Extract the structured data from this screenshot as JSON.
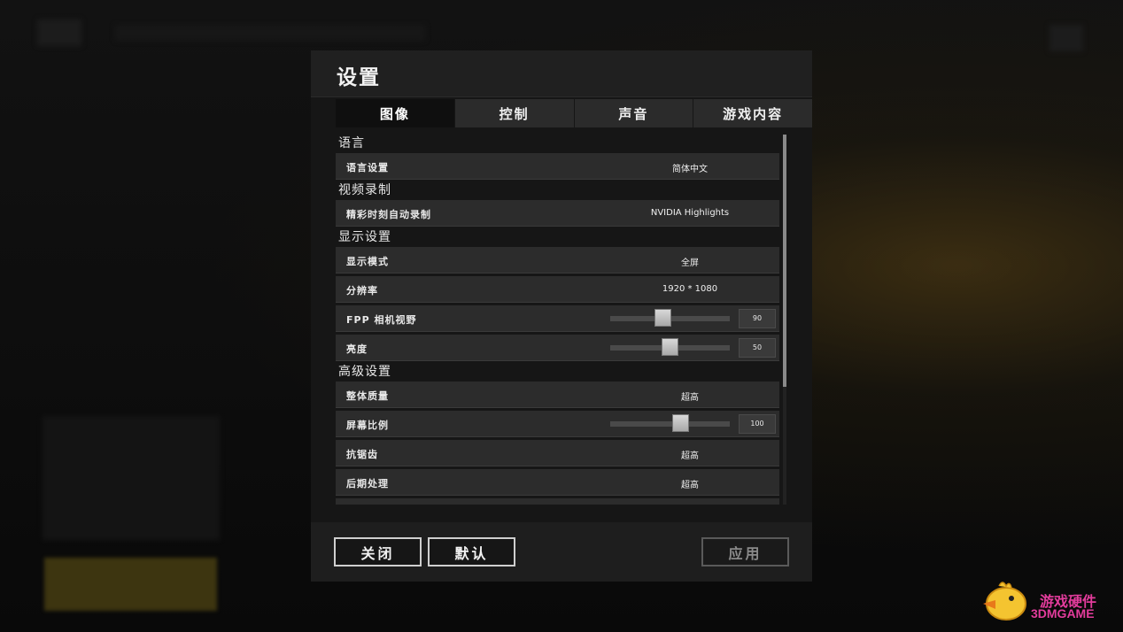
{
  "dialog": {
    "title": "设置",
    "tabs": [
      "图像",
      "控制",
      "声音",
      "游戏内容"
    ],
    "active_tab": "图像"
  },
  "sections": {
    "language": {
      "title": "语言",
      "rows": [
        {
          "label": "语言设置",
          "value": "简体中文"
        }
      ]
    },
    "video_recording": {
      "title": "视频录制",
      "rows": [
        {
          "label": "精彩时刻自动录制",
          "value": "NVIDIA Highlights"
        }
      ]
    },
    "display": {
      "title": "显示设置",
      "rows": [
        {
          "label": "显示模式",
          "value": "全屏"
        },
        {
          "label": "分辨率",
          "value": "1920 * 1080"
        },
        {
          "label": "FPP 相机视野",
          "slider_value": "90",
          "slider_fraction": 0.43
        },
        {
          "label": "亮度",
          "slider_value": "50",
          "slider_fraction": 0.5
        }
      ]
    },
    "advanced": {
      "title": "高级设置",
      "rows": [
        {
          "label": "整体质量",
          "value": "超高"
        },
        {
          "label": "屏幕比例",
          "slider_value": "100",
          "slider_fraction": 0.6
        },
        {
          "label": "抗锯齿",
          "value": "超高"
        },
        {
          "label": "后期处理",
          "value": "超高"
        }
      ]
    }
  },
  "footer": {
    "close_label": "关闭",
    "default_label": "默认",
    "apply_label": "应用"
  },
  "watermark": {
    "line1": "游戏硬件",
    "line2": "3DMGAME"
  },
  "colors": {
    "dialog_bg": "#161616",
    "row_bg": "#2c2c2c",
    "watermark": "#e33c9c"
  }
}
